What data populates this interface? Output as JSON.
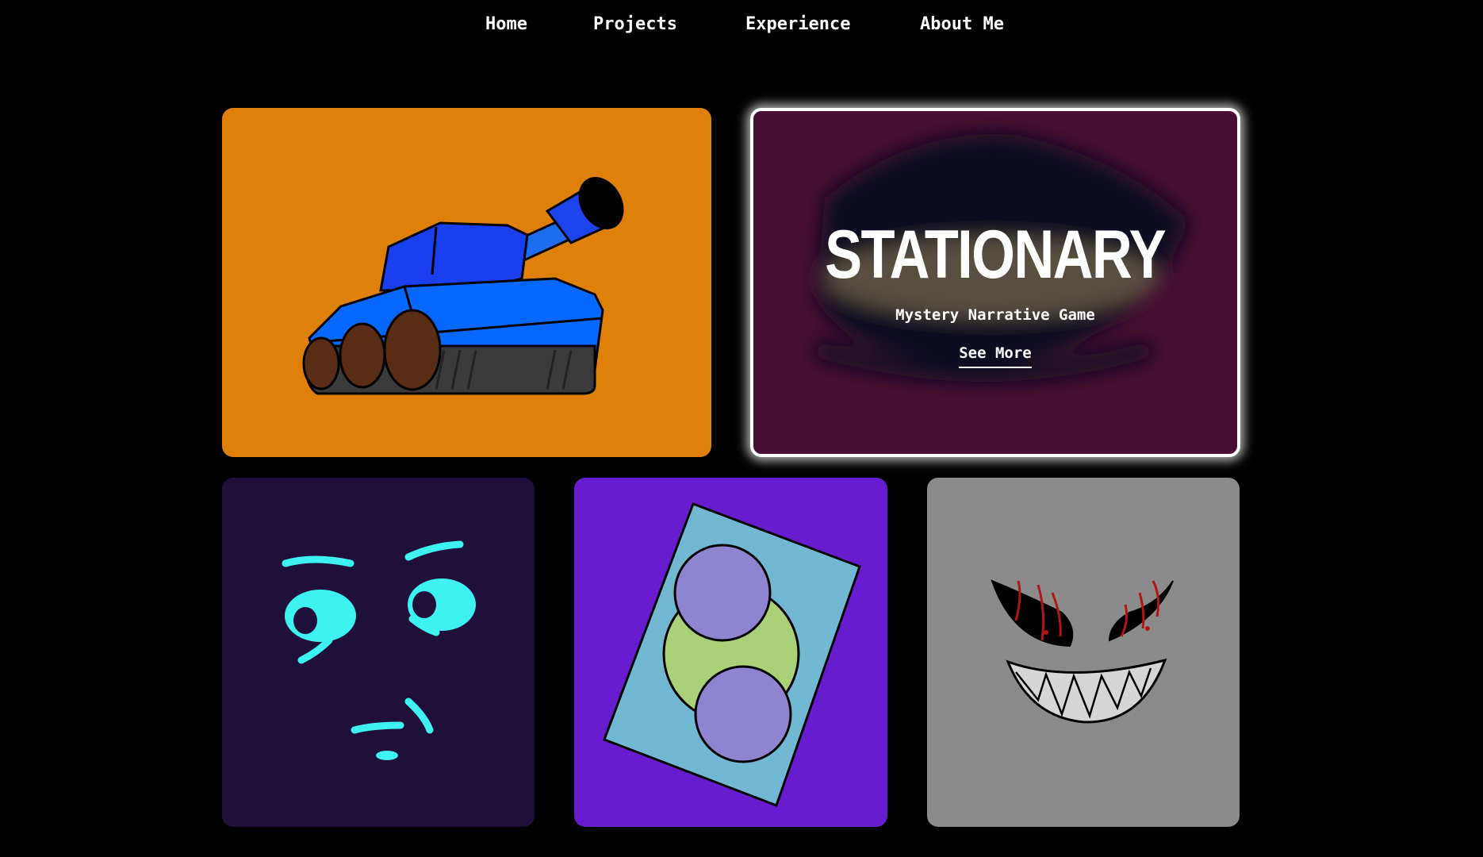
{
  "nav": {
    "home": "Home",
    "projects": "Projects",
    "experience": "Experience",
    "about": "About Me"
  },
  "cards": {
    "tank": {
      "bg": "#de800a"
    },
    "stationary": {
      "bg": "#460f31",
      "title": "STATIONARY",
      "subtitle": "Mystery Narrative Game",
      "link": "See More"
    },
    "eyes": {
      "bg": "#1e103b",
      "accent": "#3ff2f2"
    },
    "circles": {
      "bg": "#671dcf"
    },
    "grin": {
      "bg": "#8b8b8b"
    }
  }
}
